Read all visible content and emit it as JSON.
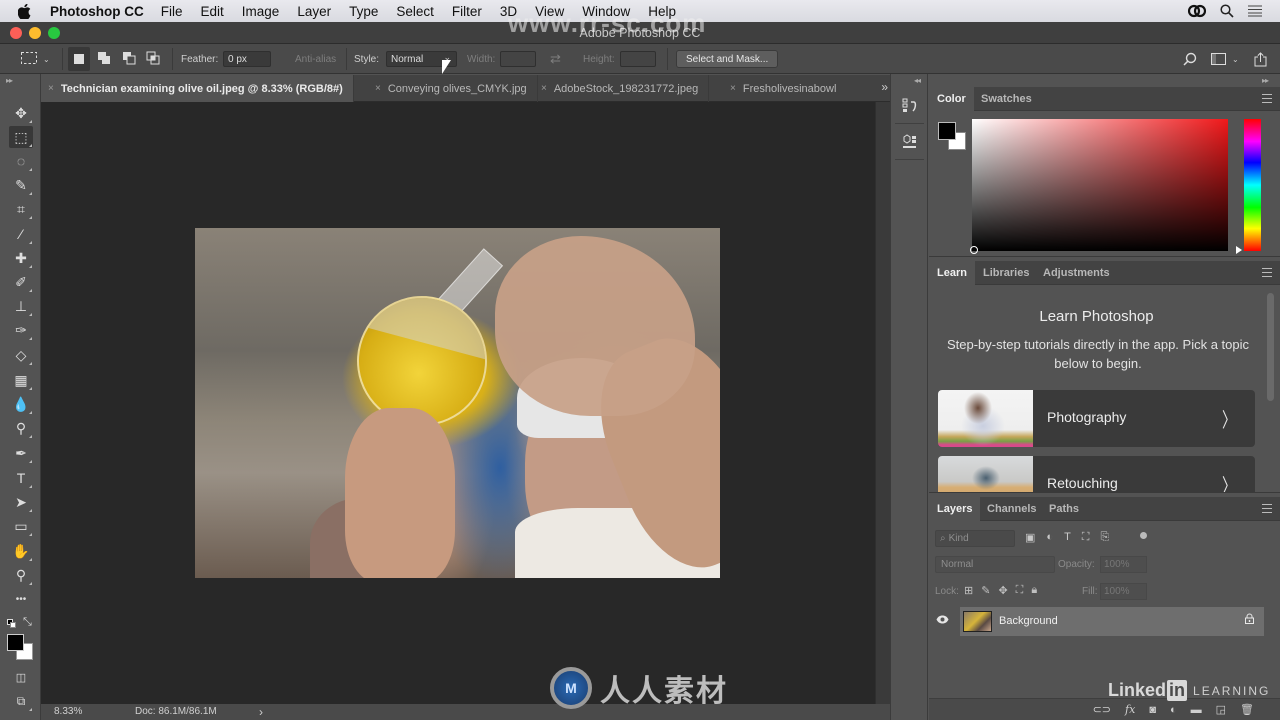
{
  "menubar": {
    "app_name": "Photoshop CC",
    "items": [
      "File",
      "Edit",
      "Image",
      "Layer",
      "Type",
      "Select",
      "Filter",
      "3D",
      "View",
      "Window",
      "Help"
    ],
    "right_icons": [
      "creative-cloud-icon",
      "spotlight-search-icon",
      "notification-center-icon"
    ]
  },
  "window": {
    "title": "Adobe Photoshop CC"
  },
  "options_bar": {
    "tool_preset_icon": "marquee-rect-icon",
    "selection_modes": [
      "new-selection",
      "add-to-selection",
      "subtract-from-selection",
      "intersect-selection"
    ],
    "feather_label": "Feather:",
    "feather_value": "0 px",
    "anti_alias_label": "Anti-alias",
    "style_label": "Style:",
    "style_value": "Normal",
    "width_label": "Width:",
    "width_value": "",
    "height_label": "Height:",
    "height_value": "",
    "select_mask_label": "Select and Mask...",
    "right_icons": [
      "search-icon",
      "workspace-icon",
      "share-icon"
    ]
  },
  "tabs": [
    {
      "label": "Technician examining olive oil.jpeg @ 8.33% (RGB/8#)",
      "active": true
    },
    {
      "label": "Conveying olives_CMYK.jpg",
      "active": false
    },
    {
      "label": "AdobeStock_198231772.jpeg",
      "active": false
    },
    {
      "label": "Fresholivesinabowl",
      "active": false
    }
  ],
  "tabs_overflow": "»",
  "tools": [
    {
      "name": "move-tool",
      "glyph": "✥"
    },
    {
      "name": "rectangular-marquee-tool",
      "glyph": "⬚",
      "active": true
    },
    {
      "name": "lasso-tool",
      "glyph": "◌"
    },
    {
      "name": "quick-selection-tool",
      "glyph": "✎"
    },
    {
      "name": "crop-tool",
      "glyph": "⌗"
    },
    {
      "name": "eyedropper-tool",
      "glyph": "⁄"
    },
    {
      "name": "healing-brush-tool",
      "glyph": "✚"
    },
    {
      "name": "brush-tool",
      "glyph": "✐"
    },
    {
      "name": "clone-stamp-tool",
      "glyph": "⊥"
    },
    {
      "name": "history-brush-tool",
      "glyph": "✑"
    },
    {
      "name": "eraser-tool",
      "glyph": "◇"
    },
    {
      "name": "gradient-tool",
      "glyph": "▦"
    },
    {
      "name": "blur-tool",
      "glyph": "💧"
    },
    {
      "name": "dodge-tool",
      "glyph": "⚲"
    },
    {
      "name": "pen-tool",
      "glyph": "✒"
    },
    {
      "name": "type-tool",
      "glyph": "T"
    },
    {
      "name": "path-selection-tool",
      "glyph": "➤"
    },
    {
      "name": "rectangle-tool",
      "glyph": "▭"
    },
    {
      "name": "hand-tool",
      "glyph": "✋"
    },
    {
      "name": "zoom-tool",
      "glyph": "⚲"
    },
    {
      "name": "edit-toolbar",
      "glyph": "•••"
    }
  ],
  "colors": {
    "foreground": "#000000",
    "background": "#ffffff",
    "accent_hue": "#f0181a"
  },
  "status": {
    "zoom": "8.33%",
    "doc": "Doc: 86.1M/86.1M",
    "arrow": "›"
  },
  "color_panel": {
    "tabs": [
      "Color",
      "Swatches"
    ],
    "active_tab": "Color"
  },
  "learn_panel": {
    "tabs": [
      "Learn",
      "Libraries",
      "Adjustments"
    ],
    "active_tab": "Learn",
    "title": "Learn Photoshop",
    "description": "Step-by-step tutorials directly in the app. Pick a topic below to begin.",
    "topics": [
      {
        "label": "Photography"
      },
      {
        "label": "Retouching"
      }
    ]
  },
  "layers_panel": {
    "tabs": [
      "Layers",
      "Channels",
      "Paths"
    ],
    "active_tab": "Layers",
    "filter_kind": "Kind",
    "blend_mode": "Normal",
    "opacity_label": "Opacity:",
    "opacity_value": "100%",
    "lock_label": "Lock:",
    "fill_label": "Fill:",
    "fill_value": "100%",
    "layers": [
      {
        "name": "Background",
        "visible": true,
        "locked": true
      }
    ],
    "footer_icons": [
      "link-layers-icon",
      "fx-icon",
      "add-mask-icon",
      "adjustment-layer-icon",
      "new-group-icon",
      "new-layer-icon",
      "delete-layer-icon"
    ]
  },
  "watermarks": {
    "url": "www.rr-sc.com",
    "rr_text": "人人素材",
    "linkedin_a": "Linked",
    "linkedin_b": "in",
    "linkedin_c": "LEARNING"
  }
}
